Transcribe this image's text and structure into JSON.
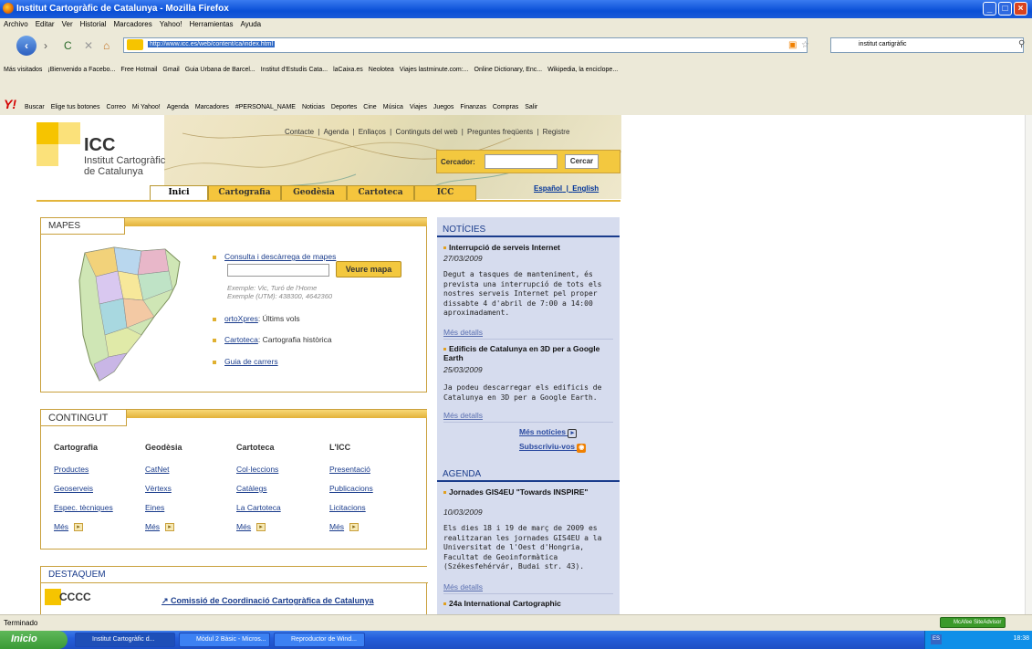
{
  "window": {
    "title": "Institut Cartogràfic de Catalunya - Mozilla Firefox"
  },
  "menubar": [
    "Archivo",
    "Editar",
    "Ver",
    "Historial",
    "Marcadores",
    "Yahoo!",
    "Herramientas",
    "Ayuda"
  ],
  "navbar": {
    "url": "http://www.icc.es/web/content/ca/index.html",
    "search_value": "institut cartigràfic"
  },
  "bookmarks": [
    "Más visitados",
    "¡Bienvenido a Facebo...",
    "Free Hotmail",
    "Gmail",
    "Guia Urbana de Barcel...",
    "Institut d'Estudis Cata...",
    "laCaixa.es",
    "Neolotea",
    "Viajes lastminute.com:...",
    "Online Dictionary, Enc...",
    "Wikipedia, la enciclope..."
  ],
  "yahoobar": [
    "Buscar",
    "Elige tus botones",
    "Correo",
    "Mi Yahoo!",
    "Agenda",
    "Marcadores",
    "#PERSONAL_NAME",
    "Noticias",
    "Deportes",
    "Cine",
    "Música",
    "Viajes",
    "Juegos",
    "Finanzas",
    "Compras",
    "Salir"
  ],
  "header": {
    "logo": "ICC",
    "logo_line1": "Institut Cartogràfic",
    "logo_line2": "de Catalunya",
    "toplinks": [
      "Contacte",
      "Agenda",
      "Enllaços",
      "Continguts del web",
      "Preguntes freqüents",
      "Registre"
    ],
    "search_label": "Cercador:",
    "search_button": "Cercar",
    "lang_es": "Español",
    "lang_en": "English",
    "tabs": [
      "Inici",
      "Cartografia",
      "Geodèsia",
      "Cartoteca",
      "ICC"
    ]
  },
  "mapes": {
    "title": "MAPES",
    "link1": "Consulta i descàrrega de mapes",
    "button": "Veure mapa",
    "example1": "Exemple: Vic, Turó de l'Home",
    "example2": "Exemple (UTM): 438300, 4642360",
    "ortoxpres": "ortoXpres",
    "ortoxpres_rest": ": Últims vols",
    "cartoteca": "Cartoteca",
    "cartoteca_rest": ": Cartografia històrica",
    "guia": "Guia de carrers"
  },
  "contingut": {
    "title": "CONTINGUT",
    "columns": [
      {
        "heading": "Cartografia",
        "links": [
          "Productes",
          "Geoserveis",
          "Espec. tècniques"
        ],
        "mes": "Més"
      },
      {
        "heading": "Geodèsia",
        "links": [
          "CatNet",
          "Vèrtexs",
          "Eines"
        ],
        "mes": "Més"
      },
      {
        "heading": "Cartoteca",
        "links": [
          "Col·leccions",
          "Catàlegs",
          "La Cartoteca"
        ],
        "mes": "Més"
      },
      {
        "heading": "L'ICC",
        "links": [
          "Presentació",
          "Publicacions",
          "Licitacions"
        ],
        "mes": "Més"
      }
    ]
  },
  "destaquem": {
    "title": "DESTAQUEM",
    "logo": "CCCC",
    "link": "Comissió de Coordinació Cartogràfica de Catalunya"
  },
  "noticies": {
    "title": "NOTÍCIES",
    "items": [
      {
        "title": "Interrupció de serveis Internet",
        "date": "27/03/2009",
        "text": "Degut a tasques de manteniment, és prevista una interrupció de tots els nostres serveis Internet pel proper dissabte 4 d'abril de 7:00 a 14:00 aproximadament.",
        "more": "Més detalls"
      },
      {
        "title": "Edificis de Catalunya en 3D per a Google Earth",
        "date": "25/03/2009",
        "text": "Ja podeu descarregar els edificis de Catalunya en 3D per a Google Earth.",
        "more": "Més detalls"
      }
    ],
    "more_news": "Més notícies",
    "subscribe": "Subscriviu-vos"
  },
  "agenda": {
    "title": "AGENDA",
    "items": [
      {
        "title": "Jornades GIS4EU \"Towards INSPIRE\"",
        "date": "10/03/2009",
        "text": "Els dies 18 i 19 de març de 2009 es realitzaran les jornades GIS4EU a la Universitat de l'Oest d'Hongria, Facultat de Geoinformàtica (Székesfehérvár, Budai str. 43).",
        "more": "Més detalls"
      },
      {
        "title": "24a International Cartographic"
      }
    ]
  },
  "statusbar": {
    "text": "Terminado",
    "mcafee": "McAfee SiteAdvisor"
  },
  "taskbar": {
    "start": "Inicio",
    "tasks": [
      "Institut Cartogràfic d...",
      "Mòdul 2 Bàsic - Micros...",
      "Reproductor de Wind..."
    ],
    "lang": "ES",
    "clock": "18:38"
  }
}
